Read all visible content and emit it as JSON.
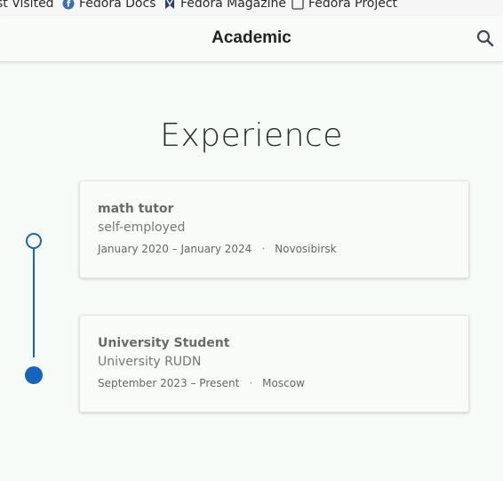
{
  "bookmarks": [
    {
      "label": "st Visited",
      "icon": "gear-icon"
    },
    {
      "label": "Fedora Docs",
      "icon": "fedora-icon"
    },
    {
      "label": "Fedora Magazine",
      "icon": "bookmark-icon"
    },
    {
      "label": "Fedora Project",
      "icon": "folder-icon"
    }
  ],
  "header": {
    "brand": "Academic",
    "search_icon": "search-icon"
  },
  "section": {
    "title": "Experience"
  },
  "experience": [
    {
      "role": "math tutor",
      "organization": "self-employed",
      "dates": "January 2020 – January 2024",
      "separator": "·",
      "location": "Novosibirsk"
    },
    {
      "role": "University Student",
      "organization": "University RUDN",
      "dates": "September 2023 – Present",
      "separator": "·",
      "location": "Moscow"
    }
  ],
  "colors": {
    "accent": "#1565c0",
    "background": "#f7fbf8",
    "card_border": "#e4e4e4"
  }
}
